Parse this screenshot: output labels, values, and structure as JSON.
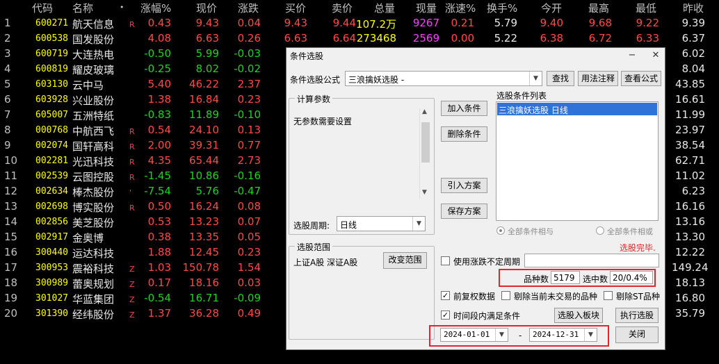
{
  "table": {
    "headers": {
      "code": "代码",
      "name": "名称",
      "dot": "•",
      "pct": "涨幅%",
      "price": "现价",
      "chg": "涨跌",
      "buy": "买价",
      "sell": "卖价",
      "vol": "总量",
      "cur": "现量",
      "spd": "涨速%",
      "turn": "换手%",
      "open": "今开",
      "high": "最高",
      "low": "最低",
      "prev": "昨收"
    },
    "rows": [
      {
        "idx": "1",
        "code": "600271",
        "name": "航天信息",
        "flag": "R",
        "pct": "0.43",
        "price": "9.43",
        "chg": "0.04",
        "buy": "9.43",
        "sell": "9.44",
        "vol": "107.2万",
        "cur": "9267",
        "spd": "0.21",
        "turn": "5.79",
        "open": "9.40",
        "high": "9.68",
        "low": "9.22",
        "prev": "9.39",
        "dir": "up"
      },
      {
        "idx": "2",
        "code": "600538",
        "name": "国发股份",
        "flag": "",
        "pct": "4.08",
        "price": "6.63",
        "chg": "0.26",
        "buy": "6.63",
        "sell": "6.64",
        "vol": "273468",
        "cur": "2569",
        "spd": "0.00",
        "turn": "5.22",
        "open": "6.38",
        "high": "6.72",
        "low": "6.33",
        "prev": "6.37",
        "dir": "up"
      },
      {
        "idx": "3",
        "code": "600719",
        "name": "大连热电",
        "flag": "",
        "pct": "-0.50",
        "price": "5.99",
        "chg": "-0.03",
        "prev": "6.02",
        "dir": "dn"
      },
      {
        "idx": "4",
        "code": "600819",
        "name": "耀皮玻璃",
        "flag": "",
        "pct": "-0.25",
        "price": "8.02",
        "chg": "-0.02",
        "prev": "8.04",
        "dir": "dn"
      },
      {
        "idx": "5",
        "code": "603130",
        "name": "云中马",
        "flag": "",
        "pct": "5.40",
        "price": "46.22",
        "chg": "2.37",
        "prev": "43.85",
        "dir": "up"
      },
      {
        "idx": "6",
        "code": "603928",
        "name": "兴业股份",
        "flag": "",
        "pct": "1.38",
        "price": "16.84",
        "chg": "0.23",
        "prev": "16.61",
        "dir": "up"
      },
      {
        "idx": "7",
        "code": "605007",
        "name": "五洲特纸",
        "flag": "",
        "pct": "-0.83",
        "price": "11.89",
        "chg": "-0.10",
        "prev": "11.99",
        "dir": "dn"
      },
      {
        "idx": "8",
        "code": "000768",
        "name": "中航西飞",
        "flag": "R",
        "pct": "0.54",
        "price": "24.10",
        "chg": "0.13",
        "prev": "23.97",
        "dir": "up"
      },
      {
        "idx": "9",
        "code": "002074",
        "name": "国轩高科",
        "flag": "R",
        "pct": "2.00",
        "price": "39.31",
        "chg": "0.77",
        "prev": "38.54",
        "dir": "up"
      },
      {
        "idx": "10",
        "code": "002281",
        "name": "光迅科技",
        "flag": "R",
        "pct": "4.35",
        "price": "65.44",
        "chg": "2.73",
        "prev": "62.71",
        "dir": "up"
      },
      {
        "idx": "11",
        "code": "002539",
        "name": "云图控股",
        "flag": "R",
        "pct": "-1.45",
        "price": "10.86",
        "chg": "-0.16",
        "prev": "11.02",
        "dir": "dn"
      },
      {
        "idx": "12",
        "code": "002634",
        "name": "棒杰股份",
        "flag": "'",
        "pct": "-7.54",
        "price": "5.76",
        "chg": "-0.47",
        "prev": "6.23",
        "dir": "dn"
      },
      {
        "idx": "13",
        "code": "002698",
        "name": "博实股份",
        "flag": "R",
        "pct": "0.50",
        "price": "16.24",
        "chg": "0.08",
        "prev": "16.16",
        "dir": "up"
      },
      {
        "idx": "14",
        "code": "002856",
        "name": "美芝股份",
        "flag": "",
        "pct": "0.53",
        "price": "13.23",
        "chg": "0.07",
        "prev": "13.16",
        "dir": "up"
      },
      {
        "idx": "15",
        "code": "002917",
        "name": "金奥博",
        "flag": "",
        "pct": "0.38",
        "price": "13.35",
        "chg": "0.05",
        "prev": "13.30",
        "dir": "up"
      },
      {
        "idx": "16",
        "code": "300440",
        "name": "运达科技",
        "flag": "",
        "pct": "1.88",
        "price": "12.45",
        "chg": "0.23",
        "prev": "12.22",
        "dir": "up"
      },
      {
        "idx": "17",
        "code": "300953",
        "name": "震裕科技",
        "flag": "Z",
        "pct": "1.03",
        "price": "150.78",
        "chg": "1.54",
        "prev": "149.24",
        "dir": "up"
      },
      {
        "idx": "18",
        "code": "300989",
        "name": "蕾奥规划",
        "flag": "Z",
        "pct": "0.17",
        "price": "18.16",
        "chg": "0.03",
        "prev": "18.13",
        "dir": "up"
      },
      {
        "idx": "19",
        "code": "301027",
        "name": "华蓝集团",
        "flag": "Z",
        "pct": "-0.54",
        "price": "16.71",
        "chg": "-0.09",
        "prev": "16.80",
        "dir": "dn"
      },
      {
        "idx": "20",
        "code": "301390",
        "name": "经纬股份",
        "flag": "Z",
        "pct": "1.37",
        "price": "36.28",
        "chg": "0.49",
        "prev": "35.79",
        "dir": "up"
      }
    ]
  },
  "dialog": {
    "title": "条件选股",
    "formula_label": "条件选股公式",
    "formula_value": "三浪擒妖选股 -",
    "btn_find": "查找",
    "btn_usage": "用法注释",
    "btn_view": "查看公式",
    "params_group": "计算参数",
    "params_text": "无参数需要设置",
    "period_label": "选股周期:",
    "period_value": "日线",
    "btn_add": "加入条件",
    "btn_delete": "删除条件",
    "btn_import": "引入方案",
    "btn_save": "保存方案",
    "list_label": "选股条件列表",
    "list_item": "三浪擒妖选股  日线",
    "radio_and": "全部条件相与",
    "radio_or": "全部条件相或",
    "status": "选股完毕.",
    "range_group": "选股范围",
    "range_text": "上证A股 深证A股",
    "btn_range": "改变范围",
    "chk_uncertain": "使用涨跌不定周期",
    "count_label": "品种数",
    "count_value": "5179",
    "selected_label": "选中数",
    "selected_value": "20/0.4%",
    "chk_adjust": "前复权数据",
    "chk_exclude_notrade": "剔除当前未交易的品种",
    "chk_exclude_st": "剔除ST品种",
    "chk_period": "时间段内满足条件",
    "btn_to_block": "选股入板块",
    "btn_run": "执行选股",
    "date_from": "2024-01-01",
    "date_sep": "-",
    "date_to": "2024-12-31",
    "btn_close": "关闭"
  }
}
